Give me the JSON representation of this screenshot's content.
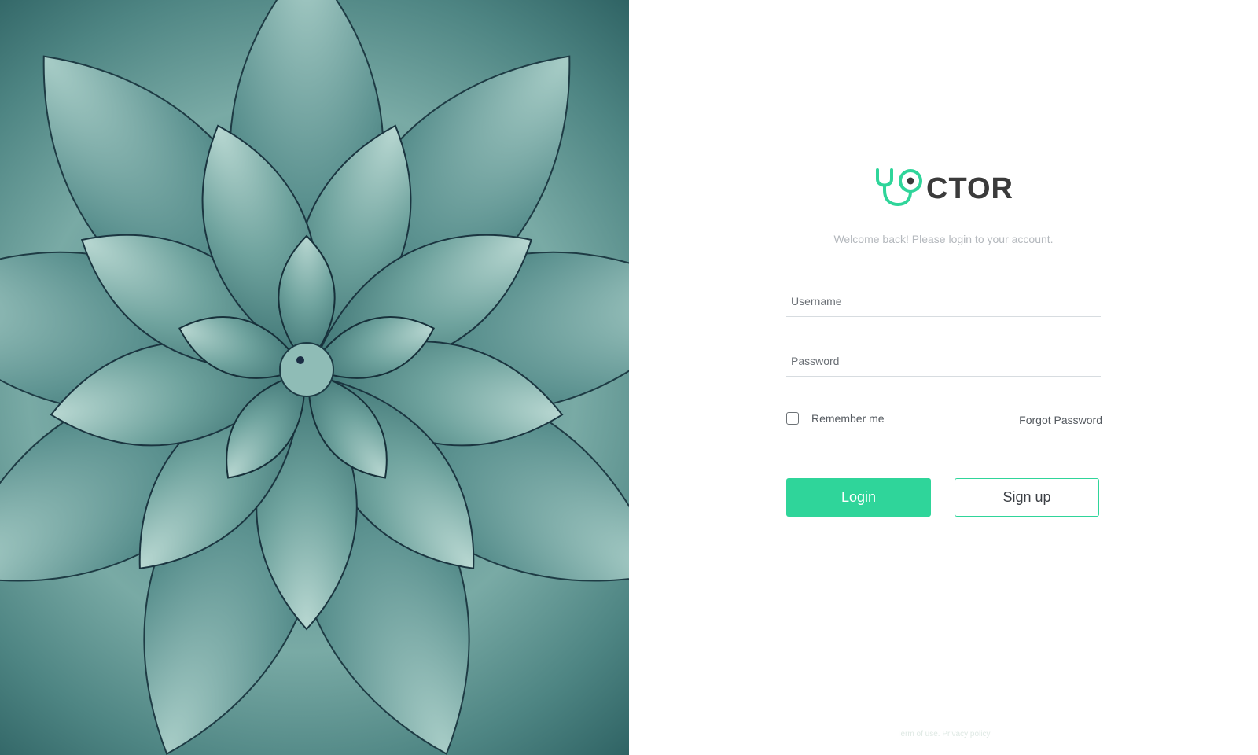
{
  "hero": {
    "description_icon": "agave-plant-photo"
  },
  "brand": {
    "logo_icon": "stethoscope-icon",
    "name_suffix": "CTOR",
    "accent_color": "#2fd59a",
    "text_color": "#3b3b3b"
  },
  "login_form": {
    "welcome_text": "Welcome back! Please login to your account.",
    "username_placeholder": "Username",
    "username_value": "",
    "password_placeholder": "Password",
    "password_value": "",
    "remember_label": "Remember me",
    "remember_checked": false,
    "forgot_label": "Forgot Password",
    "login_label": "Login",
    "signup_label": "Sign up"
  },
  "footer": {
    "terms_label": "Term of use.",
    "privacy_label": "Privacy policy"
  }
}
